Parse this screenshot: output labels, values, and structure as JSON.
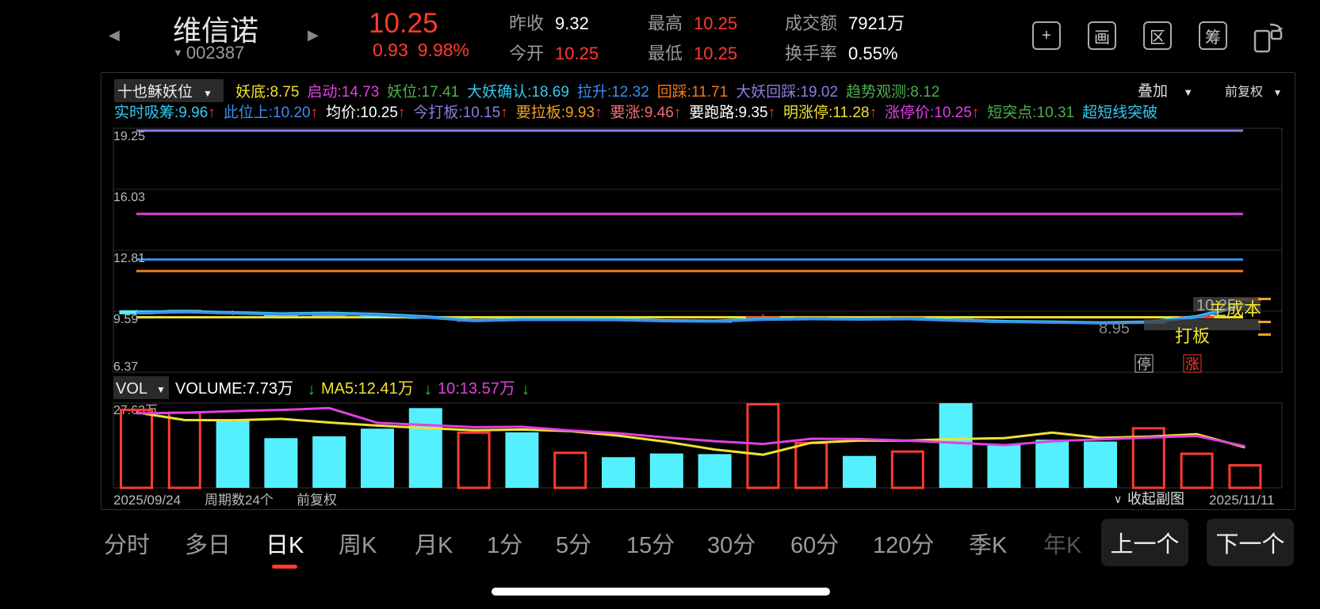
{
  "stock": {
    "name": "维信诺",
    "code": "002387",
    "price": "10.25",
    "change": "0.93",
    "change_pct": "9.98%",
    "prev_close_label": "昨收",
    "prev_close": "9.32",
    "open_label": "今开",
    "open": "10.25",
    "high_label": "最高",
    "high": "10.25",
    "low_label": "最低",
    "low": "10.25",
    "amount_label": "成交额",
    "amount": "7921万",
    "turnover_label": "换手率",
    "turnover": "0.55%"
  },
  "toolbar": {
    "add_icon_glyph": "+",
    "draw_icon_glyph": "画",
    "range_icon_glyph": "区",
    "chip_icon_glyph": "筹"
  },
  "indicator": {
    "selector": "十也稣妖位",
    "overlay": "叠加",
    "adjust": "前复权",
    "row1": [
      {
        "label": "妖底:8.75",
        "color": "#f0e130"
      },
      {
        "label": "启动:14.73",
        "color": "#e040e0"
      },
      {
        "label": "妖位:17.41",
        "color": "#4caf50"
      },
      {
        "label": "大妖确认:18.69",
        "color": "#33c9f0"
      },
      {
        "label": "拉升:12.32",
        "color": "#3a8ff0"
      },
      {
        "label": "回踩:11.71",
        "color": "#f07a1a"
      },
      {
        "label": "大妖回踩:19.02",
        "color": "#8a7de0"
      },
      {
        "label": "趋势观测:8.12",
        "color": "#4caf50"
      }
    ],
    "row2": [
      {
        "label": "实时吸筹:9.96",
        "arrow": "↑",
        "color": "#33c9f0"
      },
      {
        "label": "此位上:10.20",
        "arrow": "↑",
        "color": "#3a8ff0"
      },
      {
        "label": "均价:10.25",
        "arrow": "↑",
        "color": "#ffffff"
      },
      {
        "label": "今打板:10.15",
        "arrow": "↑",
        "color": "#8a7de0"
      },
      {
        "label": "要拉板:9.93",
        "arrow": "↑",
        "color": "#f0a020"
      },
      {
        "label": "要涨:9.46",
        "arrow": "↑",
        "color": "#f07070"
      },
      {
        "label": "要跑路:9.35",
        "arrow": "↑",
        "color": "#ffffff"
      },
      {
        "label": "明涨停:11.28",
        "arrow": "↑",
        "color": "#f0e130"
      },
      {
        "label": "涨停价:10.25",
        "arrow": "↑",
        "color": "#e040e0"
      },
      {
        "label": "短突点:10.31",
        "arrow": "",
        "color": "#4caf50"
      },
      {
        "label": "超短线突破",
        "arrow": "",
        "color": "#33c9f0"
      }
    ]
  },
  "chart_data": [
    {
      "type": "candlestick",
      "ylim": [
        6.37,
        19.25
      ],
      "y_ticks": [
        "19.25",
        "16.03",
        "12.81",
        "9.59",
        "6.37"
      ],
      "n_periods": 24,
      "candles": [
        {
          "o": 9.62,
          "h": 9.66,
          "l": 9.43,
          "c": 9.45
        },
        {
          "o": 9.54,
          "h": 9.66,
          "l": 9.5,
          "c": 9.65
        },
        {
          "o": 9.55,
          "h": 9.62,
          "l": 9.4,
          "c": 9.46
        },
        {
          "o": 9.43,
          "h": 9.49,
          "l": 9.36,
          "c": 9.4
        },
        {
          "o": 9.45,
          "h": 9.52,
          "l": 9.38,
          "c": 9.41
        },
        {
          "o": 9.4,
          "h": 9.46,
          "l": 9.33,
          "c": 9.36
        },
        {
          "o": 9.3,
          "h": 9.35,
          "l": 9.2,
          "c": 9.22
        },
        {
          "o": 9.13,
          "h": 9.17,
          "l": 9.08,
          "c": 9.14
        },
        {
          "o": 9.18,
          "h": 9.3,
          "l": 9.12,
          "c": 9.16
        },
        {
          "o": 9.18,
          "h": 9.22,
          "l": 9.13,
          "c": 9.19
        },
        {
          "o": 9.17,
          "h": 9.2,
          "l": 9.12,
          "c": 9.16
        },
        {
          "o": 9.13,
          "h": 9.17,
          "l": 9.05,
          "c": 9.07
        },
        {
          "o": 9.09,
          "h": 9.12,
          "l": 9.03,
          "c": 9.06
        },
        {
          "o": 9.22,
          "h": 9.43,
          "l": 9.18,
          "c": 9.3
        },
        {
          "o": 9.25,
          "h": 9.3,
          "l": 9.19,
          "c": 9.27
        },
        {
          "o": 9.22,
          "h": 9.26,
          "l": 9.17,
          "c": 9.21
        },
        {
          "o": 9.24,
          "h": 9.3,
          "l": 9.2,
          "c": 9.27
        },
        {
          "o": 9.17,
          "h": 9.21,
          "l": 9.1,
          "c": 9.12
        },
        {
          "o": 9.08,
          "h": 9.12,
          "l": 9.01,
          "c": 9.05
        },
        {
          "o": 9.05,
          "h": 9.08,
          "l": 8.98,
          "c": 9.0
        },
        {
          "o": 9.01,
          "h": 9.03,
          "l": 8.93,
          "c": 8.95
        },
        {
          "o": 8.99,
          "h": 9.04,
          "l": 8.95,
          "c": 9.03
        },
        {
          "o": 9.32,
          "h": 9.36,
          "l": 9.3,
          "c": 9.32
        },
        {
          "o": 10.25,
          "h": 10.25,
          "l": 10.25,
          "c": 10.25
        }
      ],
      "hlines": [
        {
          "value": 19.25,
          "color": "#8a7de0"
        },
        {
          "value": 14.73,
          "color": "#e040e0"
        },
        {
          "value": 12.32,
          "color": "#3a8ff0"
        },
        {
          "value": 11.71,
          "color": "#f07a1a"
        },
        {
          "value": 9.27,
          "color": "#f0e130"
        }
      ],
      "ma_lines": [
        {
          "color": "#33c9f0",
          "values": [
            9.56,
            9.6,
            9.53,
            9.47,
            9.5,
            9.45,
            9.32,
            9.12,
            9.18,
            9.18,
            9.17,
            9.11,
            9.09,
            9.2,
            9.22,
            9.2,
            9.22,
            9.14,
            9.07,
            9.04,
            9.0,
            9.04,
            9.33,
            9.95
          ]
        },
        {
          "color": "#3a8ff0",
          "values": [
            9.48,
            9.54,
            9.48,
            9.42,
            9.44,
            9.4,
            9.26,
            9.07,
            9.13,
            9.13,
            9.12,
            9.06,
            9.04,
            9.14,
            9.17,
            9.15,
            9.17,
            9.09,
            9.02,
            8.99,
            8.95,
            8.99,
            9.26,
            9.9
          ]
        }
      ],
      "annotations": [
        "10.25",
        "8.95",
        "主成本",
        "打板",
        "停",
        "涨"
      ]
    },
    {
      "type": "bar",
      "title": "VOL",
      "volume_label": "VOLUME:7.73万",
      "volume_arrow": "↓",
      "ma5_label": "MA5:12.41万",
      "ma5_arrow": "↓",
      "ma10_label": "10:13.57万",
      "ma10_arrow": "↓",
      "ymax_label": "27.63万",
      "ymax": 27.63,
      "values": [
        25.8,
        24.9,
        22.4,
        16.2,
        16.8,
        19.3,
        26.0,
        18.4,
        18.1,
        11.8,
        10.0,
        11.2,
        11.0,
        29.8,
        15.0,
        10.4,
        12.2,
        27.6,
        14.3,
        15.7,
        15.1,
        19.8,
        11.5,
        7.73
      ],
      "up": [
        true,
        true,
        false,
        false,
        false,
        false,
        false,
        true,
        false,
        true,
        false,
        false,
        false,
        true,
        true,
        false,
        true,
        false,
        false,
        false,
        false,
        true,
        true,
        true
      ],
      "ma5": [
        24.6,
        22.1,
        22.0,
        22.5,
        21.3,
        20.3,
        19.5,
        18.8,
        19.0,
        18.5,
        17.0,
        15.0,
        12.5,
        10.8,
        14.7,
        15.4,
        15.4,
        15.9,
        16.2,
        18.0,
        16.3,
        16.7,
        17.5,
        13.2
      ],
      "ma10": [
        24.3,
        24.5,
        25.0,
        25.4,
        26.0,
        21.2,
        20.5,
        19.8,
        19.9,
        18.7,
        17.8,
        16.4,
        15.2,
        14.3,
        16.0,
        15.9,
        15.4,
        14.7,
        13.9,
        15.2,
        15.8,
        16.4,
        16.9,
        13.57
      ]
    }
  ],
  "footer": {
    "start_date": "2025/09/24",
    "periods": "周期数24个",
    "adjust": "前复权",
    "collapse": "收起副图",
    "end_date": "2025/11/11"
  },
  "tabs": [
    "分时",
    "多日",
    "日K",
    "周K",
    "月K",
    "1分",
    "5分",
    "15分",
    "30分",
    "60分",
    "120分",
    "季K",
    "年K"
  ],
  "nav": {
    "prev": "上一个",
    "next": "下一个"
  }
}
